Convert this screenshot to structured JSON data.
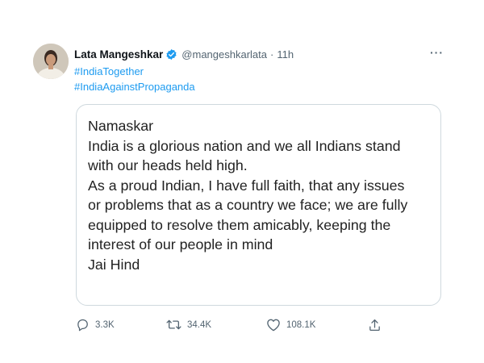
{
  "tweet": {
    "author_name": "Lata Mangeshkar",
    "handle": "@mangeshkarlata",
    "separator": "·",
    "time": "11h",
    "more_label": "···",
    "hashtags": [
      "#IndiaTogether",
      "#IndiaAgainstPropaganda"
    ],
    "image_text_lines": [
      "Namaskar",
      "India is a glorious nation and we all Indians stand",
      "with our heads held high.",
      "As a proud Indian, I have full faith, that any issues",
      "or problems that as a country we face; we are fully",
      "equipped to resolve them amicably, keeping the",
      "interest of our people in mind",
      "Jai Hind"
    ],
    "replies": "3.3K",
    "retweets": "34.4K",
    "likes": "108.1K"
  },
  "colors": {
    "accent": "#1d9bf0",
    "secondary_text": "#536471",
    "border": "#cfd9de"
  },
  "icons": {
    "verified": "verified-badge-icon",
    "more": "more-horizontal-icon",
    "reply": "reply-icon",
    "retweet": "retweet-icon",
    "like": "heart-icon",
    "share": "share-icon"
  }
}
